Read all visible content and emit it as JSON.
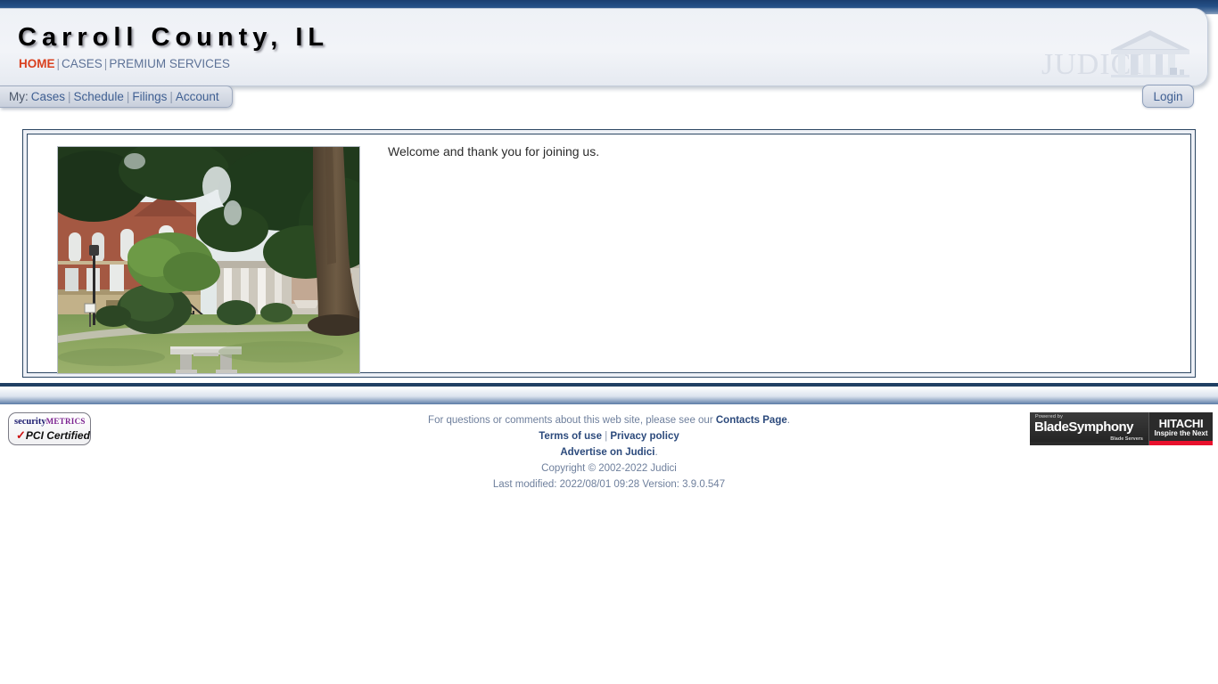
{
  "header": {
    "site_title": "Carroll County, IL",
    "nav": [
      {
        "label": "HOME",
        "active": true
      },
      {
        "label": "CASES",
        "active": false
      },
      {
        "label": "PREMIUM SERVICES",
        "active": false
      }
    ],
    "separator": "|",
    "logo_text": "JUDICI",
    "logo_icon": "courthouse-icon"
  },
  "subnav": {
    "my_label": "My:",
    "items": [
      {
        "label": "Cases"
      },
      {
        "label": "Schedule"
      },
      {
        "label": "Filings"
      },
      {
        "label": "Account"
      }
    ],
    "separator": "|",
    "login_label": "Login"
  },
  "main": {
    "welcome_message": "Welcome and thank you for joining us.",
    "photo_alt": "Carroll County courthouse lawn with trees and stone bench"
  },
  "footer": {
    "contact_line_prefix": "For questions or comments about this web site, please see our ",
    "contact_link": "Contacts Page",
    "contact_line_suffix": ".",
    "terms_link": "Terms of use",
    "separator": "|",
    "privacy_link": "Privacy policy",
    "advertise_link": "Advertise on Judici",
    "advertise_suffix": ".",
    "copyright": "Copyright © 2002-2022 Judici",
    "last_modified": "Last modified: 2022/08/01 09:28 Version: 3.9.0.547",
    "pci_badge": {
      "word_security": "security",
      "word_metrics": "METRICS",
      "check": "✓",
      "certified": "PCI Certified"
    },
    "hitachi_badge": {
      "powered_by": "Powered by",
      "blade_name": "BladeSymphony",
      "blade_servers": "Blade Servers",
      "hitachi_name": "HITACHI",
      "hitachi_tagline": "Inspire the Next"
    }
  },
  "colors": {
    "top_bar_dark": "#1b3f71",
    "accent_red": "#d9401f",
    "link_blue": "#3f5f92",
    "footer_text": "#5d7297",
    "border_navy": "#2d4763",
    "hitachi_red": "#e8112d"
  }
}
